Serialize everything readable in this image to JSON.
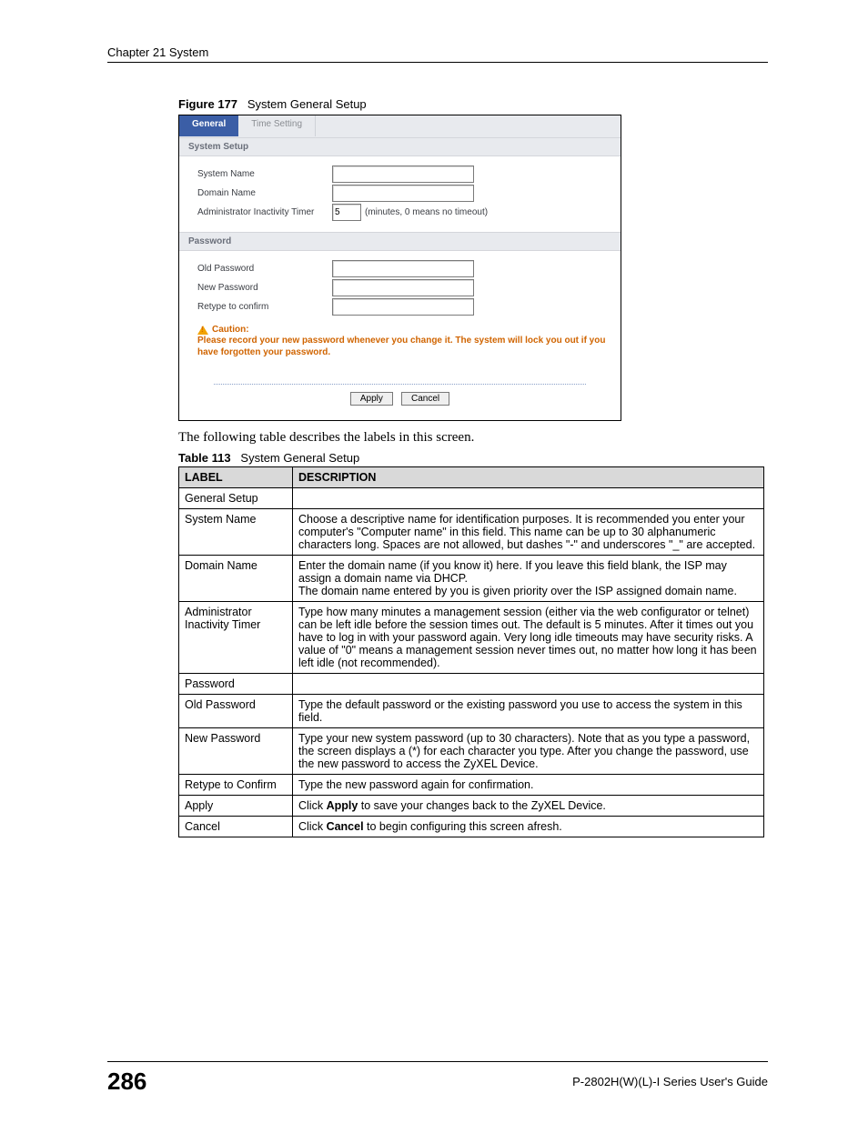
{
  "chapter": "Chapter 21 System",
  "figure_label": "Figure 177",
  "figure_title": "System General Setup",
  "tabs": {
    "general": "General",
    "time": "Time Setting"
  },
  "sections": {
    "system_setup": "System Setup",
    "password": "Password"
  },
  "form": {
    "system_name_label": "System Name",
    "domain_name_label": "Domain Name",
    "inactivity_label": "Administrator Inactivity Timer",
    "inactivity_value": "5",
    "inactivity_hint": "(minutes, 0 means no timeout)",
    "old_pw_label": "Old Password",
    "new_pw_label": "New Password",
    "retype_label": "Retype to confirm"
  },
  "caution": {
    "title": "Caution:",
    "text": "Please record your new password whenever you change it. The system will lock you out if you have forgotten your password."
  },
  "buttons": {
    "apply": "Apply",
    "cancel": "Cancel"
  },
  "intro_text": "The following table describes the labels in this screen.",
  "table_label": "Table 113",
  "table_title": "System General Setup",
  "table_headers": {
    "label": "LABEL",
    "description": "DESCRIPTION"
  },
  "rows": [
    {
      "label": "General Setup",
      "desc": ""
    },
    {
      "label": "System Name",
      "desc": "Choose a descriptive name for identification purposes. It is recommended you enter your computer's \"Computer name\" in this field. This name can be up to 30 alphanumeric characters long. Spaces are not allowed, but dashes \"-\" and underscores \"_\" are accepted."
    },
    {
      "label": "Domain Name",
      "desc": "Enter the domain name (if you know it) here. If you leave this field blank, the ISP may assign a domain name via DHCP.\nThe domain name entered by you is given priority over the ISP assigned domain name."
    },
    {
      "label": "Administrator Inactivity Timer",
      "desc": "Type how many minutes a management session (either via the web configurator or telnet) can be left idle before the session times out. The default is 5 minutes. After it times out you have to log in with your password again. Very long idle timeouts may have security risks. A value of \"0\" means a management session never times out, no matter how long it has been left idle (not recommended)."
    },
    {
      "label": "Password",
      "desc": ""
    },
    {
      "label": "Old Password",
      "desc": "Type the default password or the existing password you use to access the system in this field."
    },
    {
      "label": "New Password",
      "desc": "Type your new system password (up to 30 characters). Note that as you type a password, the screen displays a (*) for each character you type. After you change the password, use the new password to access the ZyXEL Device."
    },
    {
      "label": "Retype to Confirm",
      "desc": "Type the new password again for confirmation."
    },
    {
      "label": "Apply",
      "desc_pre": "Click ",
      "desc_bold": "Apply",
      "desc_post": " to save your changes back to the ZyXEL Device."
    },
    {
      "label": "Cancel",
      "desc_pre": "Click ",
      "desc_bold": "Cancel",
      "desc_post": " to begin configuring this screen afresh."
    }
  ],
  "footer": {
    "page_number": "286",
    "guide": "P-2802H(W)(L)-I Series User's Guide"
  }
}
